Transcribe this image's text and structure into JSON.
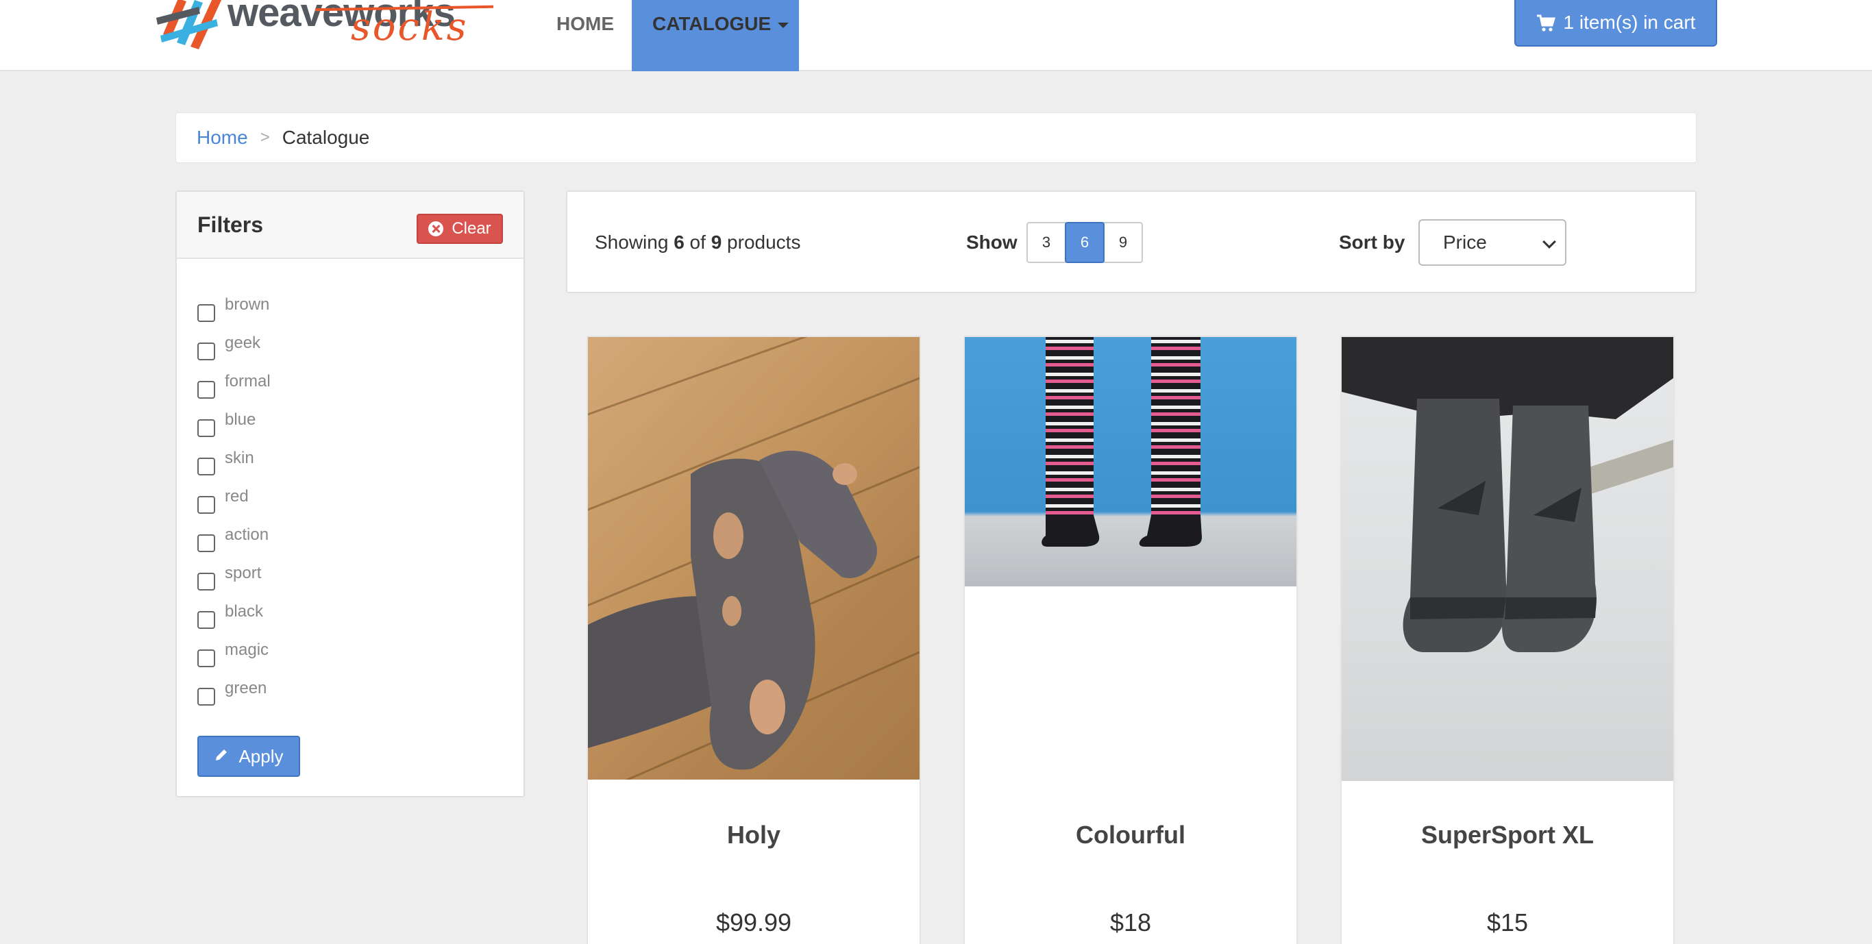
{
  "brand": {
    "word1": "weaveworks",
    "word2": "socks"
  },
  "nav": {
    "home": "HOME",
    "catalogue": "CATALOGUE",
    "cart": "1 item(s) in cart"
  },
  "breadcrumb": {
    "home": "Home",
    "separator": ">",
    "current": "Catalogue"
  },
  "filters": {
    "title": "Filters",
    "clear": "Clear",
    "apply": "Apply",
    "tags": [
      "brown",
      "geek",
      "formal",
      "blue",
      "skin",
      "red",
      "action",
      "sport",
      "black",
      "magic",
      "green"
    ]
  },
  "toolbar": {
    "showing_prefix": "Showing",
    "shown": "6",
    "of": "of",
    "total": "9",
    "showing_suffix": "products",
    "show_label": "Show",
    "page_sizes": [
      "3",
      "6",
      "9"
    ],
    "active_page_size": "6",
    "sort_label": "Sort by",
    "sort_value": "Price"
  },
  "products": [
    {
      "name": "Holy",
      "price": "$99.99"
    },
    {
      "name": "Colourful",
      "price": "$18"
    },
    {
      "name": "SuperSport XL",
      "price": "$15"
    }
  ],
  "colors": {
    "accent": "#5a8fdb",
    "danger": "#d9534f",
    "brand_orange": "#e8562a"
  }
}
